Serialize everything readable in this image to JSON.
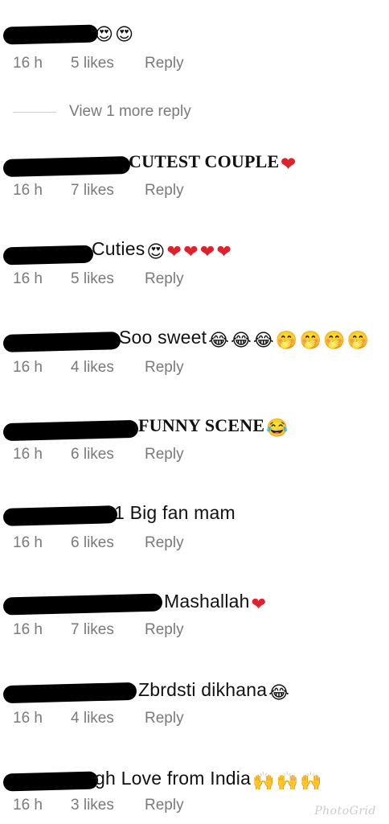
{
  "comments": [
    {
      "text": "",
      "emojis": [
        "😍",
        "😍"
      ],
      "time": "16 h",
      "likes": "5 likes",
      "reply": "Reply"
    },
    {
      "text": "CUTEST COUPLE",
      "emojis": [
        "❤"
      ],
      "time": "16 h",
      "likes": "7 likes",
      "reply": "Reply"
    },
    {
      "text": "Cuties",
      "emojis": [
        "😍",
        "❤",
        "❤",
        "❤",
        "❤"
      ],
      "time": "16 h",
      "likes": "5 likes",
      "reply": "Reply"
    },
    {
      "text": "Soo sweet",
      "emojis": [
        "😂",
        "😂",
        "😂",
        "🤭",
        "🤭",
        "🤭",
        "🤭"
      ],
      "time": "16 h",
      "likes": "4 likes",
      "reply": "Reply"
    },
    {
      "text": "FUNNY SCENE",
      "emojis": [
        "😂"
      ],
      "time": "16 h",
      "likes": "6 likes",
      "reply": "Reply"
    },
    {
      "text": "1 Big fan mam",
      "emojis": [],
      "time": "16 h",
      "likes": "6 likes",
      "reply": "Reply"
    },
    {
      "text": "Mashallah",
      "emojis": [
        "❤"
      ],
      "time": "16 h",
      "likes": "7 likes",
      "reply": "Reply"
    },
    {
      "text": "Zbrdsti dikhana",
      "emojis": [
        "😂"
      ],
      "time": "16 h",
      "likes": "4 likes",
      "reply": "Reply"
    },
    {
      "text": "gh Love from India",
      "emojis": [
        "🙌",
        "🙌",
        "🙌"
      ],
      "time": "16 h",
      "likes": "3 likes",
      "reply": "Reply"
    }
  ],
  "view_more_label": "View 1 more reply",
  "watermark": "PhotoGrid"
}
